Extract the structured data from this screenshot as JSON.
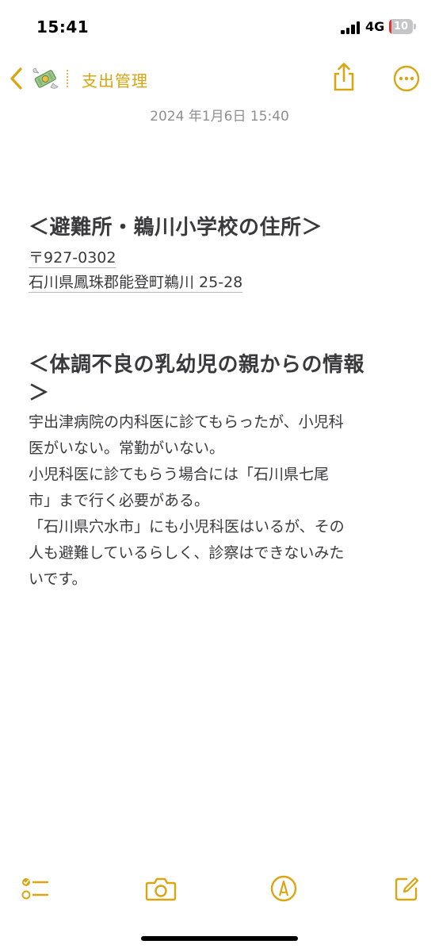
{
  "status_bar": {
    "time": "15:41",
    "network": "4G",
    "battery_level": "10",
    "battery_fraction": 0.1
  },
  "nav": {
    "folder_title": "支出管理",
    "back_icon": "chevron-left-icon",
    "folder_icon": "money-with-wings-icon",
    "share_icon": "share-icon",
    "more_icon": "ellipsis-circle-icon"
  },
  "note": {
    "date": "2024 年1月6日 15:40",
    "sections": [
      {
        "heading": "＜避難所・鵜川小学校の住所＞",
        "lines": [
          "〒927-0302",
          "石川県鳳珠郡能登町鵜川 25-28"
        ]
      },
      {
        "heading_lines": [
          "＜体調不良の乳幼児の親からの情報",
          "＞"
        ],
        "paragraph_lines": [
          "宇出津病院の内科医に診てもらったが、小児科",
          "医がいない。常勤がいない。",
          "小児科医に診てもらう場合には「石川県七尾",
          "市」まで行く必要がある。",
          "「石川県穴水市」にも小児科医はいるが、その",
          "人も避難しているらしく、診察はできないみた",
          "いです。"
        ]
      }
    ]
  },
  "toolbar": {
    "checklist_icon": "checklist-icon",
    "camera_icon": "camera-icon",
    "markup_icon": "markup-pen-icon",
    "compose_icon": "compose-icon"
  },
  "colors": {
    "accent": "#d9a511",
    "text": "#3a3a3c",
    "secondary": "#8e8e93",
    "battery_low": "#e5312b"
  }
}
